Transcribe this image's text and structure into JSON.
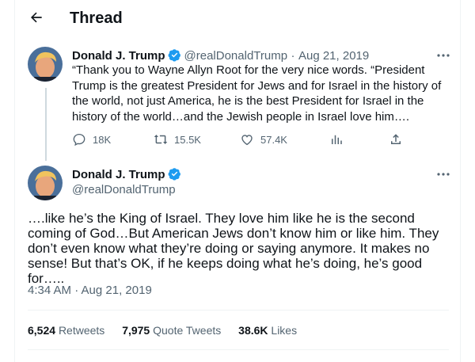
{
  "header": {
    "title": "Thread"
  },
  "parent_tweet": {
    "name": "Donald J. Trump",
    "handle": "@realDonaldTrump",
    "separator": "·",
    "date": "Aug 21, 2019",
    "text": "“Thank you to Wayne Allyn Root for the very nice words. “President Trump is the greatest President for Jews and for Israel in the history of the world, not just America, he is the best President for Israel in the history of the world…and the Jewish people in Israel love him….",
    "replies": "18K",
    "retweets": "15.5K",
    "likes": "57.4K"
  },
  "main_tweet": {
    "name": "Donald J. Trump",
    "handle": "@realDonaldTrump",
    "text": "….like he’s the King of Israel. They love him like he is the second coming of God…But American Jews don’t know him or like him. They don’t even know what they’re doing or saying anymore. It makes no sense! But that’s OK, if he keeps doing what he’s doing, he’s good for…..",
    "time": "4:34 AM · Aug 21, 2019",
    "stats": {
      "retweets_count": "6,524",
      "retweets_label": "Retweets",
      "quotes_count": "7,975",
      "quotes_label": "Quote Tweets",
      "likes_count": "38.6K",
      "likes_label": "Likes"
    }
  },
  "colors": {
    "accent": "#1d9bf0",
    "muted": "#536471",
    "text": "#0f1419"
  },
  "icons": [
    "back-arrow-icon",
    "verified-badge-icon",
    "more-icon",
    "reply-icon",
    "retweet-icon",
    "like-icon",
    "analytics-icon",
    "share-icon"
  ]
}
